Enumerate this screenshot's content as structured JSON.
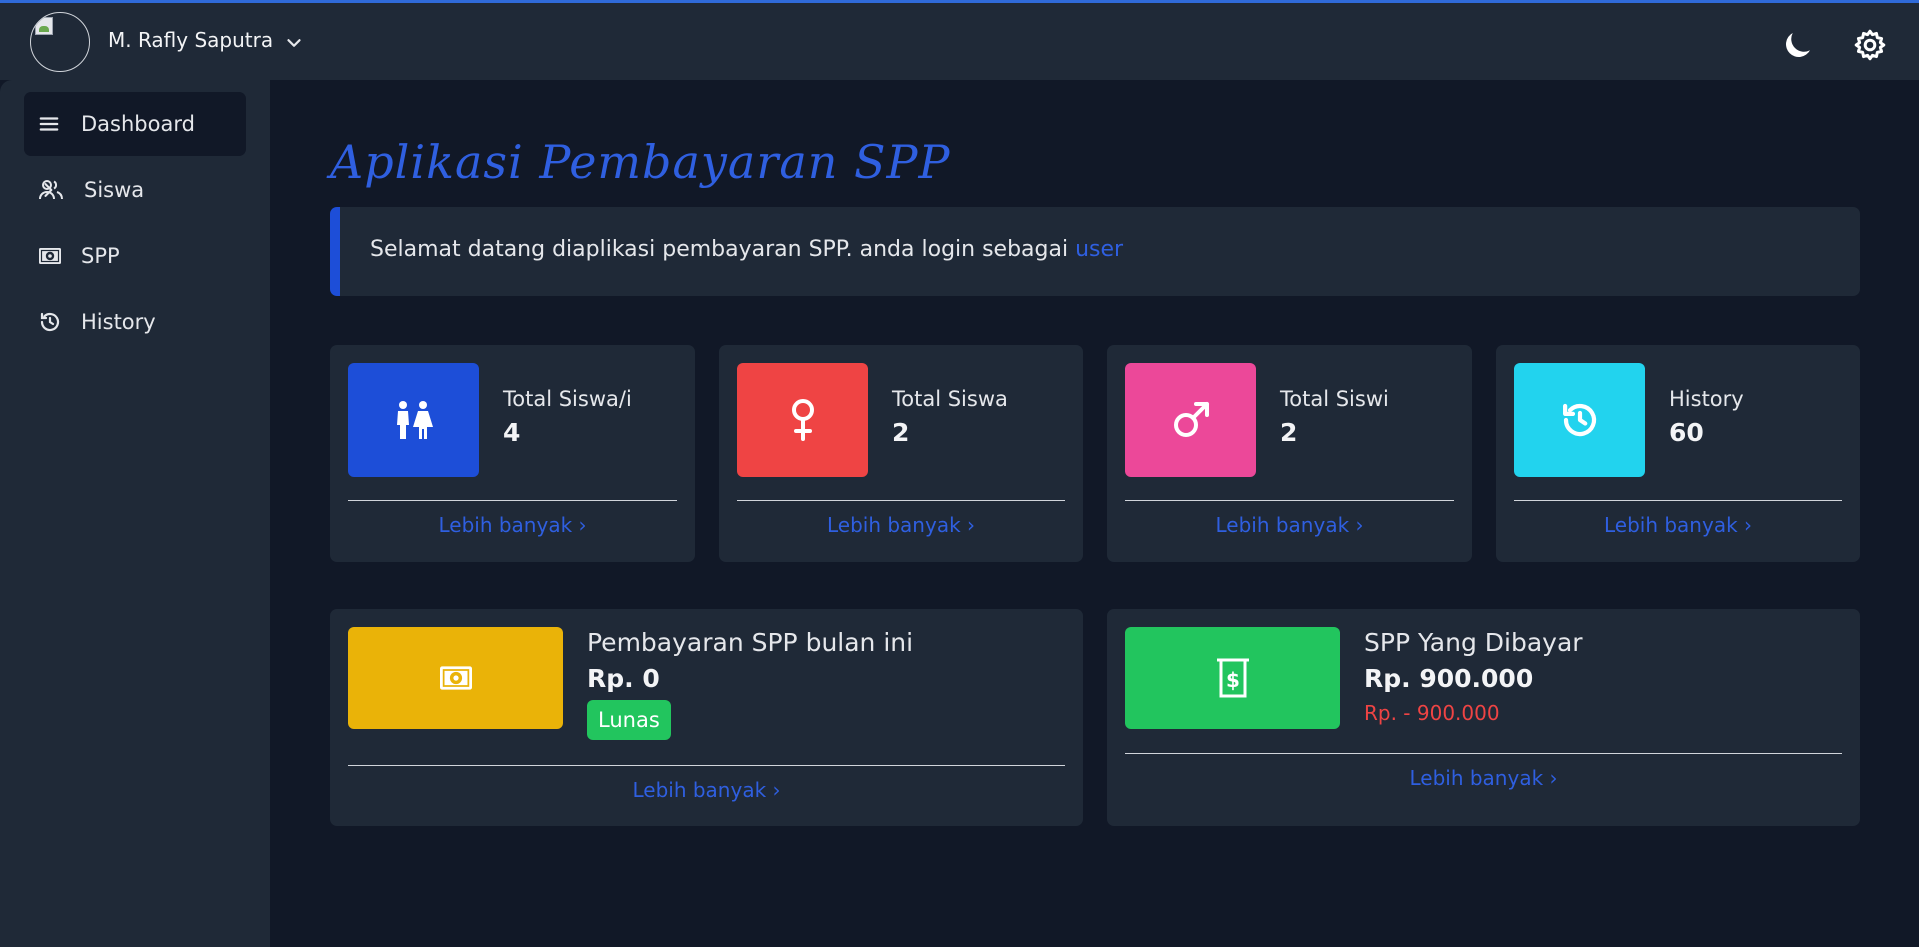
{
  "colors": {
    "accent": "#2f5fe0",
    "blue": "#1d4ed8",
    "red": "#ef4444",
    "pink": "#ec4899",
    "cyan": "#22d3ee",
    "yellow": "#eab308",
    "green": "#22c55e"
  },
  "header": {
    "user_name": "M. Rafly Saputra",
    "icons": [
      "avatar",
      "chevron-down-icon",
      "moon-icon",
      "gear-icon"
    ]
  },
  "sidebar": {
    "items": [
      {
        "label": "Dashboard",
        "icon": "menu-icon"
      },
      {
        "label": "Siswa",
        "icon": "users-icon"
      },
      {
        "label": "SPP",
        "icon": "money-icon"
      },
      {
        "label": "History",
        "icon": "history-icon"
      }
    ]
  },
  "main": {
    "title": "Aplikasi Pembayaran SPP",
    "welcome": {
      "text": "Selamat datang diaplikasi pembayaran SPP. anda login sebagai ",
      "role": "user"
    },
    "stats": [
      {
        "label": "Total Siswa/i",
        "value": "4",
        "more": "Lebih banyak ›",
        "icon": "restroom-icon"
      },
      {
        "label": "Total Siswa",
        "value": "2",
        "more": "Lebih banyak ›",
        "icon": "female-icon"
      },
      {
        "label": "Total Siswi",
        "value": "2",
        "more": "Lebih banyak ›",
        "icon": "male-icon"
      },
      {
        "label": "History",
        "value": "60",
        "more": "Lebih banyak ›",
        "icon": "history-icon"
      }
    ],
    "payment_month": {
      "label": "Pembayaran SPP bulan ini",
      "value": "Rp. 0",
      "badge": "Lunas",
      "more": "Lebih banyak ›",
      "icon": "money-icon"
    },
    "payment_paid": {
      "label": "SPP Yang Dibayar",
      "value": "Rp. 900.000",
      "sub": "Rp. - 900.000",
      "more": "Lebih banyak ›",
      "icon": "dollar-receipt-icon"
    }
  }
}
